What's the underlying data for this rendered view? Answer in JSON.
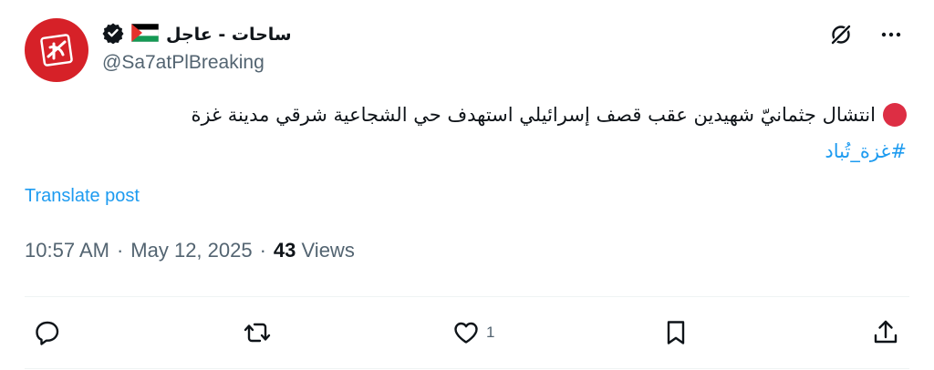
{
  "author": {
    "display_name": "ساحات - عاجل",
    "handle": "@Sa7atPlBreaking",
    "verified": true,
    "flag": "Palestine",
    "avatar_color": "#d62128"
  },
  "tweet": {
    "text": "انتشال جثمانيّ شهيدين عقب قصف إسرائيلي استهدف حي الشجاعية شرقي مدينة غزة",
    "hashtag": "#غزة_تُباد",
    "lead_emoji": "red-circle"
  },
  "translate_label": "Translate post",
  "meta": {
    "time": "10:57 AM",
    "separator": "·",
    "date": "May 12, 2025",
    "views_count": "43",
    "views_label": "Views"
  },
  "actions": {
    "likes_count": "1"
  },
  "colors": {
    "accent": "#1d9bf0",
    "muted": "#536471",
    "text": "#0f1419",
    "red_dot": "#dd2e44"
  }
}
